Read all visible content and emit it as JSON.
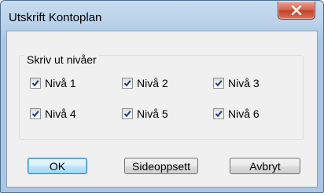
{
  "window": {
    "title": "Utskrift Kontoplan",
    "close_icon": "close-x-icon"
  },
  "group": {
    "legend": "Skriv ut nivåer",
    "levels": [
      {
        "label": "Nivå 1",
        "checked": true
      },
      {
        "label": "Nivå 2",
        "checked": true
      },
      {
        "label": "Nivå 3",
        "checked": true
      },
      {
        "label": "Nivå 4",
        "checked": true
      },
      {
        "label": "Nivå 5",
        "checked": true
      },
      {
        "label": "Nivå 6",
        "checked": true
      }
    ]
  },
  "buttons": {
    "ok": "OK",
    "page_setup": "Sideoppsett",
    "cancel": "Avbryt"
  }
}
